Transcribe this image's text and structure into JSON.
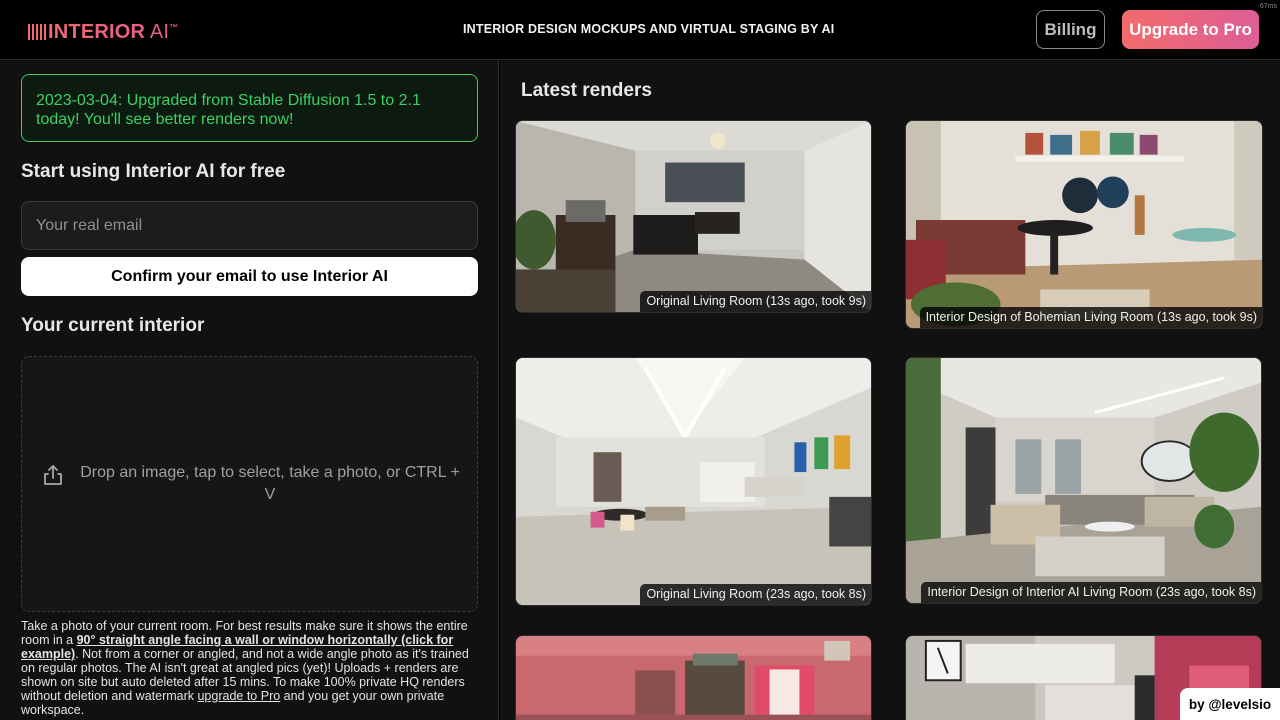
{
  "header": {
    "logo_main": "INTERIOR",
    "logo_light": " AI",
    "logo_tm": "™",
    "tagline": "INTERIOR DESIGN MOCKUPS AND VIRTUAL STAGING BY AI",
    "billing_label": "Billing",
    "upgrade_label": "Upgrade to Pro",
    "corner_tag": "67ms"
  },
  "left": {
    "notice": "2023-03-04: Upgraded from Stable Diffusion 1.5 to 2.1 today! You'll see better renders now!",
    "start_heading": "Start using Interior AI for free",
    "email_placeholder": "Your real email",
    "confirm_label": "Confirm your email to use Interior AI",
    "current_heading": "Your current interior",
    "drop_text": "Drop an image, tap to select, take a photo, or CTRL + V",
    "help": {
      "part1": "Take a photo of your current room. For best results make sure it shows the entire room in a ",
      "bold_link": "90° straight angle facing a wall or window horizontally (click for example)",
      "part2": ". Not from a corner or angled, and not a wide angle photo as it's trained on regular photos. The AI isn't great at angled pics (yet)! Uploads + renders are shown on site but auto deleted after 15 mins. To make 100% private HQ renders without deletion and watermark ",
      "link": "upgrade to Pro",
      "part3": " and you get your own private workspace."
    }
  },
  "right": {
    "latest_heading": "Latest renders",
    "renders": [
      {
        "caption": "Original Living Room (13s ago, took 9s)"
      },
      {
        "caption": "Interior Design of Bohemian Living Room (13s ago, took 9s)"
      },
      {
        "caption": "Original Living Room (23s ago, took 8s)"
      },
      {
        "caption": "Interior Design of Interior AI Living Room (23s ago, took 8s)"
      },
      {
        "caption": ""
      },
      {
        "caption": ""
      }
    ]
  },
  "footer": {
    "by_label": "by @levelsio"
  },
  "colors": {
    "notice_green": "#3bd162",
    "brand_gradient_start": "#f36b6b",
    "brand_gradient_end": "#dd5e96"
  }
}
